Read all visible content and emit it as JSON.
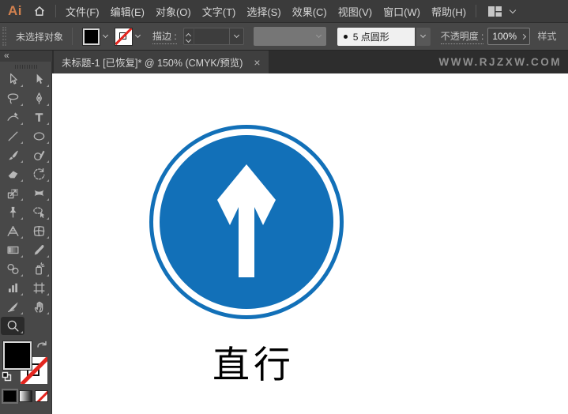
{
  "menubar": {
    "logo": "Ai",
    "items": [
      "文件(F)",
      "编辑(E)",
      "对象(O)",
      "文字(T)",
      "选择(S)",
      "效果(C)",
      "视图(V)",
      "窗口(W)",
      "帮助(H)"
    ]
  },
  "controlbar": {
    "status": "未选择对象",
    "fill_color": "#000000",
    "stroke_style": "none",
    "stroke_label": "描边 :",
    "brush_bullet": "•",
    "brush_name": "5 点圆形",
    "opacity_label": "不透明度 :",
    "opacity_value": "100%",
    "style_label": "样式"
  },
  "tabbar": {
    "collapse_icon": "«",
    "tab_title": "未标题-1 [已恢复]* @ 150% (CMYK/预览)",
    "close_label": "×",
    "watermark": "WWW.RJZXW.COM"
  },
  "toolbar": {
    "tools": [
      "selection-tool",
      "direct-selection-tool",
      "lasso-tool",
      "pen-tool",
      "curvature-tool",
      "type-tool",
      "line-segment-tool",
      "ellipse-tool",
      "paintbrush-tool",
      "shaper-tool",
      "eraser-tool",
      "rotate-tool",
      "scale-tool",
      "width-tool",
      "puppet-warp-tool",
      "shape-builder-tool",
      "perspective-grid-tool",
      "mesh-tool",
      "gradient-tool",
      "eyedropper-tool",
      "blend-tool",
      "symbol-sprayer-tool",
      "column-graph-tool",
      "artboard-tool",
      "slice-tool",
      "hand-tool",
      "zoom-tool"
    ],
    "active_tool": "zoom-tool",
    "fill": "#000000",
    "stroke": "none"
  },
  "canvas": {
    "sign_label": "直行",
    "sign_blue": "#1270B8",
    "arrow_color": "#ffffff"
  }
}
